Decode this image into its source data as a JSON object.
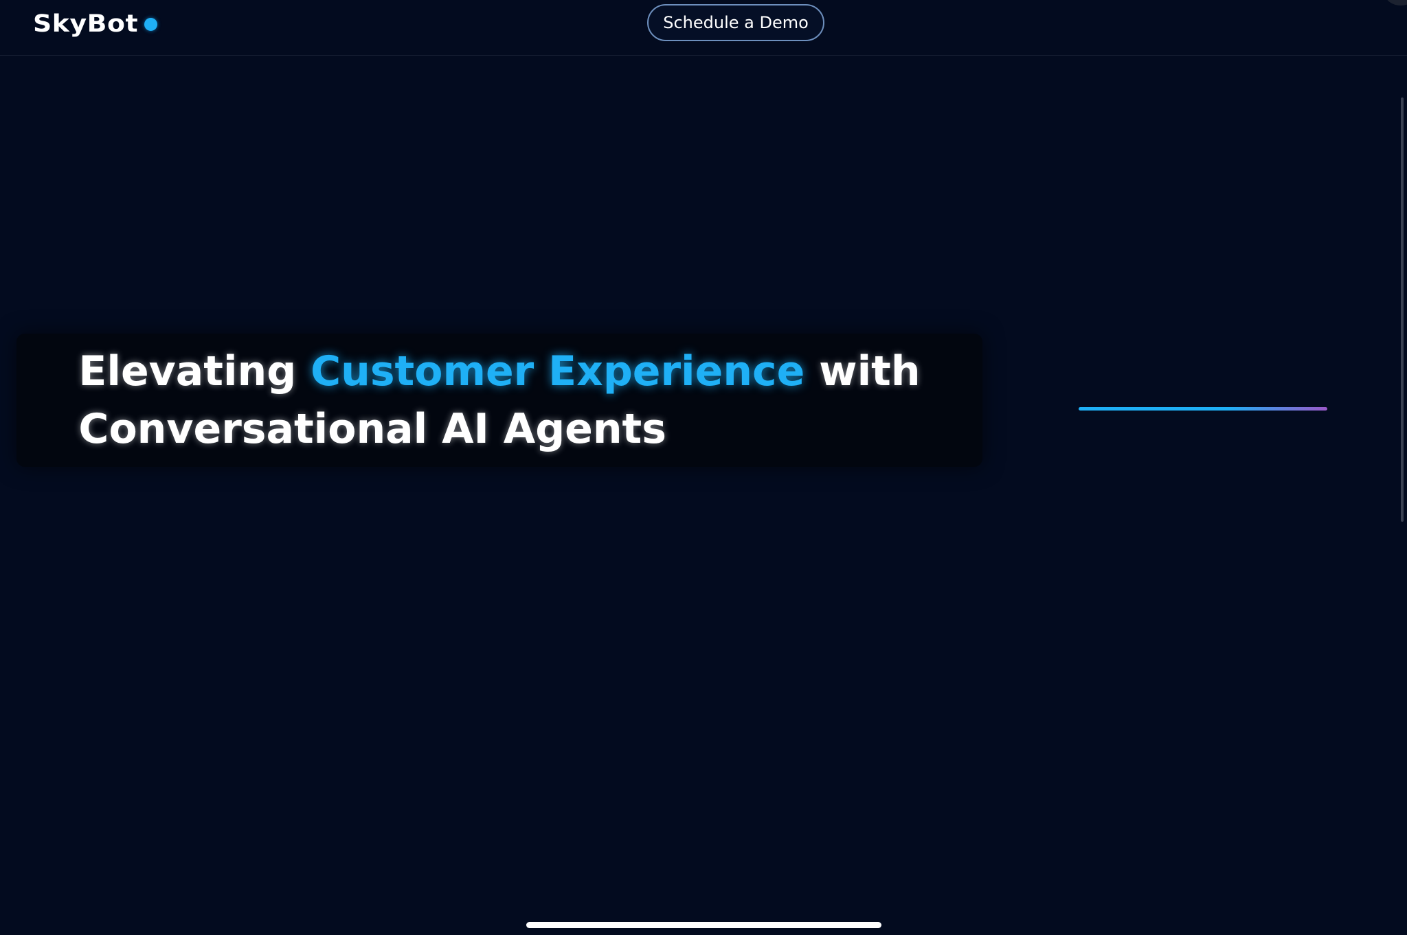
{
  "header": {
    "brand_name": "SkyBot",
    "cta_label": "Schedule a Demo"
  },
  "hero": {
    "line1_lead": "Elevating ",
    "line1_highlight": "Customer Experience",
    "line1_tail": " with",
    "line2": "Conversational AI Agents"
  },
  "colors": {
    "background": "#030b1f",
    "accent": "#1fb0f6",
    "accent_gradient_end": "#9b59c9",
    "button_border": "#6d8fbd",
    "text": "#ffffff"
  },
  "icons": {
    "brand_status": "status-dot-icon"
  }
}
